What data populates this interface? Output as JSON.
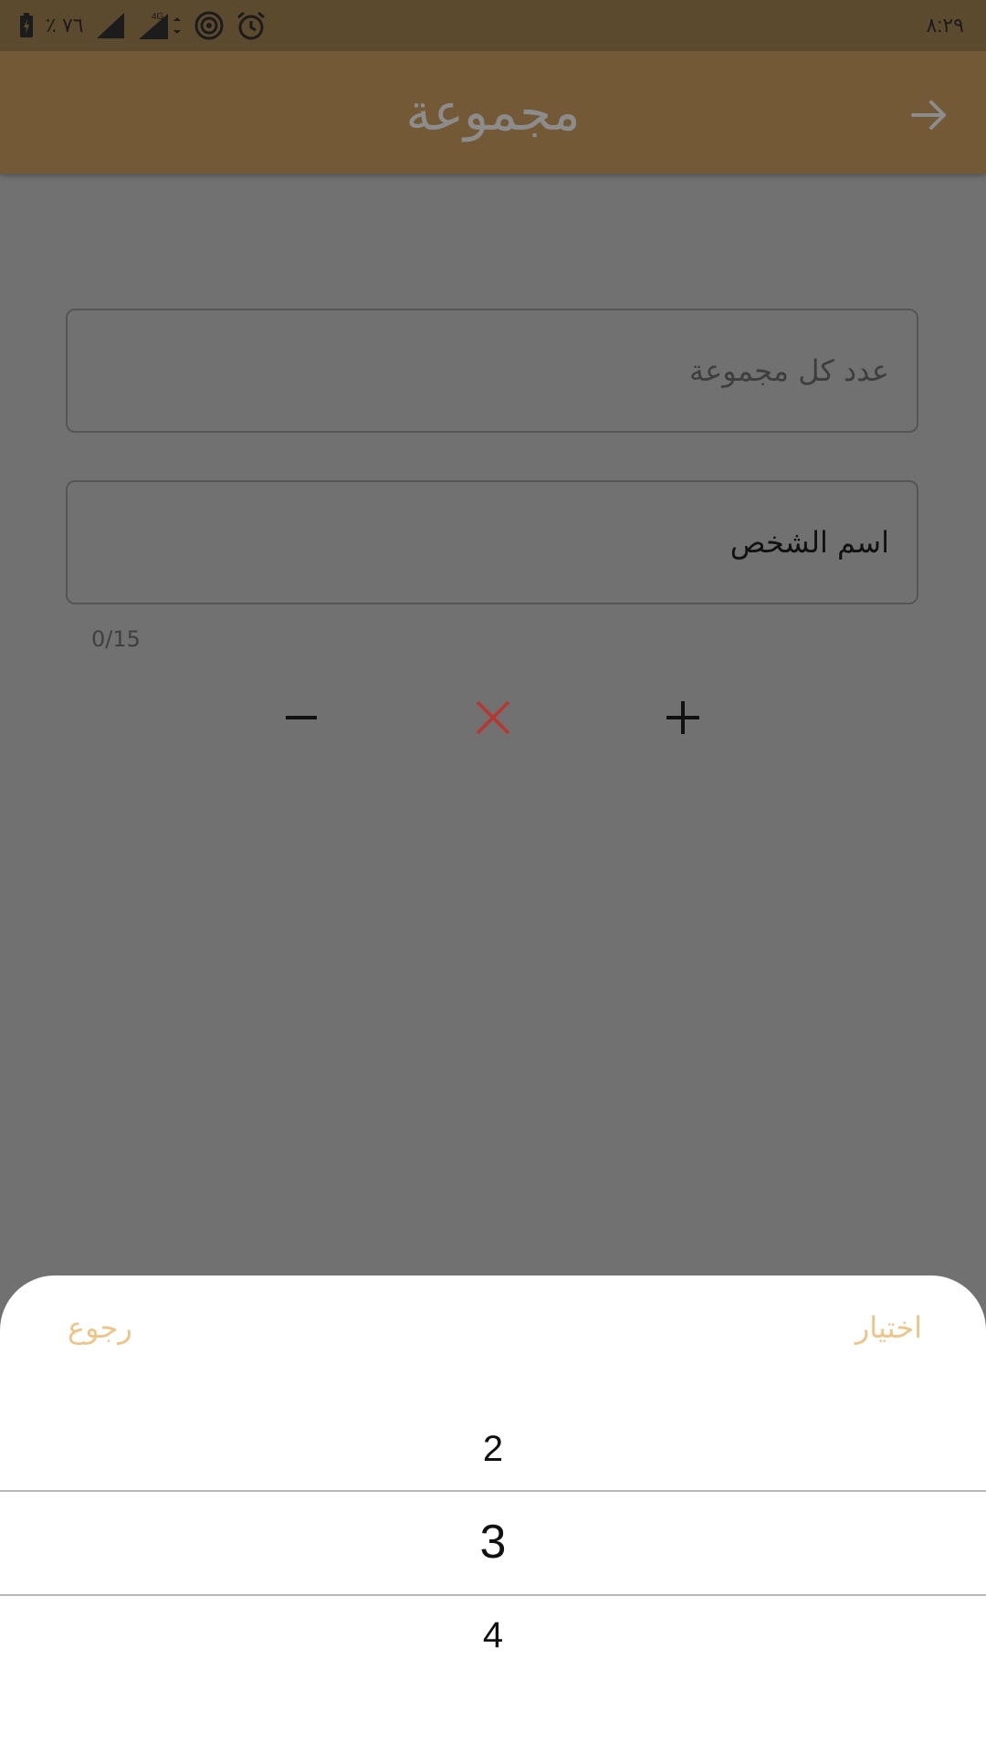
{
  "status_bar": {
    "battery_percent": "٪ ٧٦",
    "network": "4G",
    "time": "٨:٢٩"
  },
  "app_bar": {
    "title": "مجموعة",
    "back_icon": "arrow-right-icon"
  },
  "form": {
    "group_count_placeholder": "عدد كل مجموعة",
    "person_name_value": "اسم الشخص",
    "counter": "0/15"
  },
  "controls": {
    "minus_icon": "minus-icon",
    "close_icon": "close-icon",
    "plus_icon": "plus-icon",
    "close_color": "#b33a34"
  },
  "picker_sheet": {
    "choose_label": "اختيار",
    "back_label": "رجوع",
    "options": [
      "2",
      "3",
      "4"
    ],
    "selected": "3",
    "accent_color": "#efc489"
  }
}
